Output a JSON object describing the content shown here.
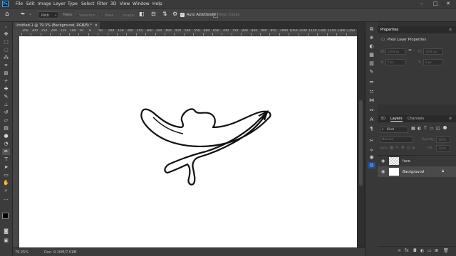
{
  "menubar": {
    "logo": "Ps",
    "items": [
      "File",
      "Edit",
      "Image",
      "Layer",
      "Type",
      "Select",
      "Filter",
      "3D",
      "View",
      "Window",
      "Help"
    ],
    "window_controls": [
      "–",
      "□",
      "✕"
    ]
  },
  "optbar": {
    "mode": "Path",
    "make": "Make:",
    "selection": "Selection...",
    "mask": "Mask",
    "shape": "Shape",
    "auto_add_delete": "Auto Add/Delete",
    "auto_add_delete_checked": true,
    "align_edges": "Align Edges"
  },
  "document": {
    "tab_title": "Untitled-1 @ 79.3% (Background, RGB/8) *",
    "close": "×"
  },
  "ruler": {
    "h_labels": [
      "350",
      "300",
      "250",
      "200",
      "150",
      "100",
      "50",
      "0",
      "50",
      "100",
      "150",
      "200",
      "250",
      "300",
      "350",
      "400",
      "450",
      "500",
      "550",
      "600",
      "650",
      "700",
      "750",
      "800",
      "850",
      "900",
      "950",
      "1000",
      "1050",
      "1100",
      "1150",
      "1200",
      "1250",
      "1300",
      "1350"
    ]
  },
  "status": {
    "zoom": "79.25%",
    "doc": "Doc: 9.16M/7.61M"
  },
  "properties": {
    "tab": "Properties",
    "title": "Pixel Layer Properties",
    "w_label": "W:",
    "w_value": "1500 px",
    "h_label": "H:",
    "h_value": "1000 px",
    "x_label": "X:",
    "x_value": "0 px",
    "y_label": "Y:",
    "y_value": "0 px"
  },
  "layers_panel": {
    "tabs": [
      "3D",
      "Layers",
      "Channels"
    ],
    "active_tab": "Layers",
    "filter": "Kind",
    "blend_mode": "Normal",
    "opacity_label": "Opacity:",
    "opacity_value": "100%",
    "lock_label": "Lock:",
    "fill_label": "Fill:",
    "fill_value": "100%",
    "layers": [
      {
        "name": "face",
        "visible": true,
        "type": "transparent"
      },
      {
        "name": "Background",
        "visible": true,
        "type": "white",
        "locked": true
      }
    ]
  },
  "colors": {
    "accent": "#31a8ff",
    "canvas": "#ffffff"
  }
}
